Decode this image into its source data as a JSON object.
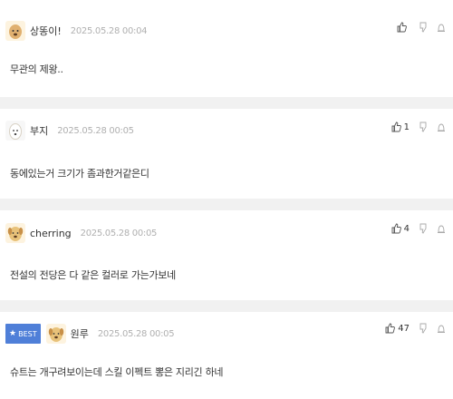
{
  "comments": [
    {
      "nickname": "상똥이!",
      "date": "2025.05.28 00:04",
      "text": "무관의 제왕..",
      "likes": "",
      "best": false
    },
    {
      "nickname": "부지",
      "date": "2025.05.28 00:05",
      "text": "동에있는거 크기가 좀과한거같은디",
      "likes": "1",
      "best": false
    },
    {
      "nickname": "cherring",
      "date": "2025.05.28 00:05",
      "text": "전설의 전당은 다 같은 컬러로 가는가보네",
      "likes": "4",
      "best": false
    },
    {
      "nickname": "원루",
      "date": "2025.05.28 00:05",
      "text": "슈트는 개구려보이는데 스킬 이펙트 뽕은 지리긴 하네",
      "likes": "47",
      "best": true,
      "best_label": "BEST"
    }
  ],
  "colors": {
    "best_badge": "#4f7fd8",
    "separator": "#f1f1f1",
    "date": "#b0b0b0"
  },
  "icons": {
    "like": "thumbs-up-icon",
    "dislike": "thumbs-down-icon",
    "report": "siren-icon"
  }
}
